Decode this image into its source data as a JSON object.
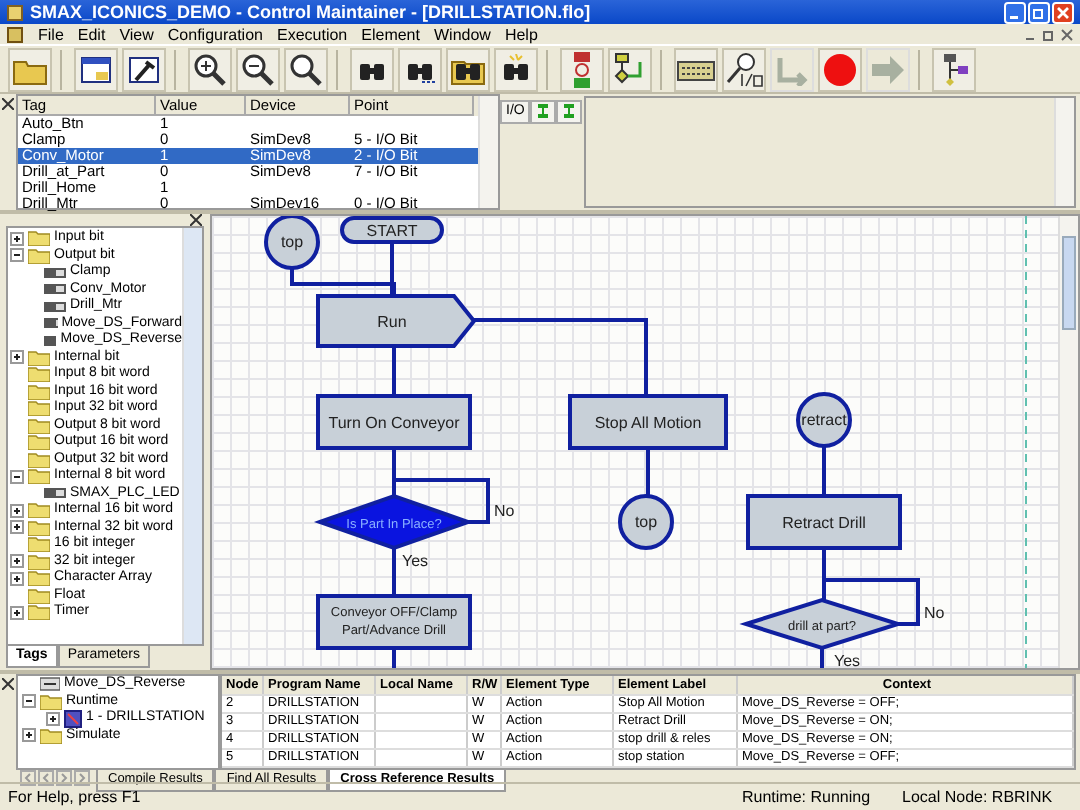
{
  "window": {
    "title": "SMAX_ICONICS_DEMO - Control Maintainer - [DRILLSTATION.flo]"
  },
  "menu": [
    "File",
    "Edit",
    "View",
    "Configuration",
    "Execution",
    "Element",
    "Window",
    "Help"
  ],
  "toolbar": [
    {
      "kind": "open",
      "disabled": false
    },
    {
      "kind": "sep"
    },
    {
      "kind": "window",
      "disabled": false
    },
    {
      "kind": "hammer",
      "disabled": false
    },
    {
      "kind": "sep"
    },
    {
      "kind": "zoom-in",
      "disabled": false
    },
    {
      "kind": "zoom-out",
      "disabled": false
    },
    {
      "kind": "zoom-fit",
      "disabled": false
    },
    {
      "kind": "sep"
    },
    {
      "kind": "find",
      "disabled": false
    },
    {
      "kind": "find-next",
      "disabled": false
    },
    {
      "kind": "find-folder",
      "disabled": false
    },
    {
      "kind": "find-light",
      "disabled": false
    },
    {
      "kind": "sep"
    },
    {
      "kind": "network",
      "disabled": false
    },
    {
      "kind": "flow",
      "disabled": false
    },
    {
      "kind": "sep"
    },
    {
      "kind": "keyboard",
      "disabled": false
    },
    {
      "kind": "io-search",
      "disabled": false
    },
    {
      "kind": "step",
      "disabled": true
    },
    {
      "kind": "record",
      "disabled": false
    },
    {
      "kind": "run",
      "disabled": true
    },
    {
      "kind": "sep"
    },
    {
      "kind": "tree",
      "disabled": false
    }
  ],
  "tag_table": {
    "columns": [
      "Tag",
      "Value",
      "Device",
      "Point"
    ],
    "rows": [
      {
        "cells": [
          "Auto_Btn",
          "1",
          "",
          ""
        ],
        "selected": false
      },
      {
        "cells": [
          "Clamp",
          "0",
          "SimDev8",
          "5 - I/O Bit"
        ],
        "selected": false
      },
      {
        "cells": [
          "Conv_Motor",
          "1",
          "SimDev8",
          "2 - I/O Bit"
        ],
        "selected": true
      },
      {
        "cells": [
          "Drill_at_Part",
          "0",
          "SimDev8",
          "7 - I/O Bit"
        ],
        "selected": false
      },
      {
        "cells": [
          "Drill_Home",
          "1",
          "",
          ""
        ],
        "selected": false
      },
      {
        "cells": [
          "Drill_Mtr",
          "0",
          "SimDev16",
          "0 - I/O Bit"
        ],
        "selected": false
      }
    ]
  },
  "io_button": "I/O",
  "tree": [
    {
      "label": "Input bit",
      "kind": "folder",
      "expanded": false
    },
    {
      "label": "Output bit",
      "kind": "folder",
      "expanded": true,
      "children": [
        {
          "label": "Clamp",
          "kind": "tag"
        },
        {
          "label": "Conv_Motor",
          "kind": "tag"
        },
        {
          "label": "Drill_Mtr",
          "kind": "tag"
        },
        {
          "label": "Move_DS_Forward",
          "kind": "tag"
        },
        {
          "label": "Move_DS_Reverse",
          "kind": "tag"
        }
      ]
    },
    {
      "label": "Internal bit",
      "kind": "folder",
      "expanded": false
    },
    {
      "label": "Input 8 bit word",
      "kind": "folder"
    },
    {
      "label": "Input 16 bit word",
      "kind": "folder"
    },
    {
      "label": "Input 32 bit word",
      "kind": "folder"
    },
    {
      "label": "Output 8 bit word",
      "kind": "folder"
    },
    {
      "label": "Output 16 bit word",
      "kind": "folder"
    },
    {
      "label": "Output 32 bit word",
      "kind": "folder"
    },
    {
      "label": "Internal 8 bit word",
      "kind": "folder",
      "expanded": true,
      "children": [
        {
          "label": "SMAX_PLC_LED",
          "kind": "tag"
        }
      ]
    },
    {
      "label": "Internal 16 bit word",
      "kind": "folder",
      "expanded": false
    },
    {
      "label": "Internal 32 bit word",
      "kind": "folder",
      "expanded": false
    },
    {
      "label": "16 bit integer",
      "kind": "folder"
    },
    {
      "label": "32 bit integer",
      "kind": "folder",
      "expanded": false
    },
    {
      "label": "Character Array",
      "kind": "folder",
      "expanded": false
    },
    {
      "label": "Float",
      "kind": "folder"
    },
    {
      "label": "Timer",
      "kind": "folder",
      "expanded": false
    }
  ],
  "tree_tabs": [
    {
      "label": "Tags",
      "selected": true
    },
    {
      "label": "Parameters",
      "selected": false
    }
  ],
  "flowchart": {
    "nodes": [
      {
        "kind": "connector",
        "label": "top",
        "selected": false
      },
      {
        "kind": "start",
        "label": "START",
        "selected": false
      },
      {
        "kind": "step",
        "label": "Run",
        "selected": false
      },
      {
        "kind": "action",
        "label": "Turn On Conveyor",
        "selected": false
      },
      {
        "kind": "decision",
        "label": "Is Part In Place?",
        "selected": true
      },
      {
        "kind": "action",
        "label": "Conveyor OFF/Clamp Part/Advance Drill",
        "selected": false
      },
      {
        "kind": "action",
        "label": "Stop All Motion",
        "selected": false
      },
      {
        "kind": "connector",
        "label": "top",
        "selected": false
      },
      {
        "kind": "connector",
        "label": "retract",
        "selected": false
      },
      {
        "kind": "action",
        "label": "Retract Drill",
        "selected": false
      },
      {
        "kind": "decision",
        "label": "drill at part?",
        "selected": false
      }
    ],
    "branch_labels": [
      "No",
      "Yes",
      "No",
      "Yes"
    ]
  },
  "results_tree": {
    "label": "Move_DS_Reverse",
    "children": [
      {
        "label": "Runtime",
        "expanded": true,
        "children": [
          {
            "label": "1 - DRILLSTATION",
            "expanded": false
          }
        ]
      },
      {
        "label": "Simulate",
        "expanded": false
      }
    ]
  },
  "results_table": {
    "columns": [
      "Node",
      "Program Name",
      "Local Name",
      "R/W",
      "Element Type",
      "Element Label",
      "Context"
    ],
    "rows": [
      {
        "node": "2",
        "program": "DRILLSTATION",
        "rw": "W",
        "type": "Action",
        "label": "Stop All Motion",
        "context": "Move_DS_Reverse =  OFF;"
      },
      {
        "node": "3",
        "program": "DRILLSTATION",
        "rw": "W",
        "type": "Action",
        "label": "Retract Drill",
        "context": "Move_DS_Reverse =  ON;"
      },
      {
        "node": "4",
        "program": "DRILLSTATION",
        "rw": "W",
        "type": "Action",
        "label": "stop drill & reles",
        "context": "Move_DS_Reverse = ON;"
      },
      {
        "node": "5",
        "program": "DRILLSTATION",
        "rw": "W",
        "type": "Action",
        "label": "stop station",
        "context": "Move_DS_Reverse =  OFF;"
      }
    ]
  },
  "result_tabs": [
    {
      "label": "Compile Results",
      "selected": false
    },
    {
      "label": "Find All Results",
      "selected": false
    },
    {
      "label": "Cross Reference Results",
      "selected": true
    }
  ],
  "status_bar": {
    "help": "For Help, press F1",
    "runtime": "Runtime: Running",
    "node": "Local Node: RBRINK"
  }
}
